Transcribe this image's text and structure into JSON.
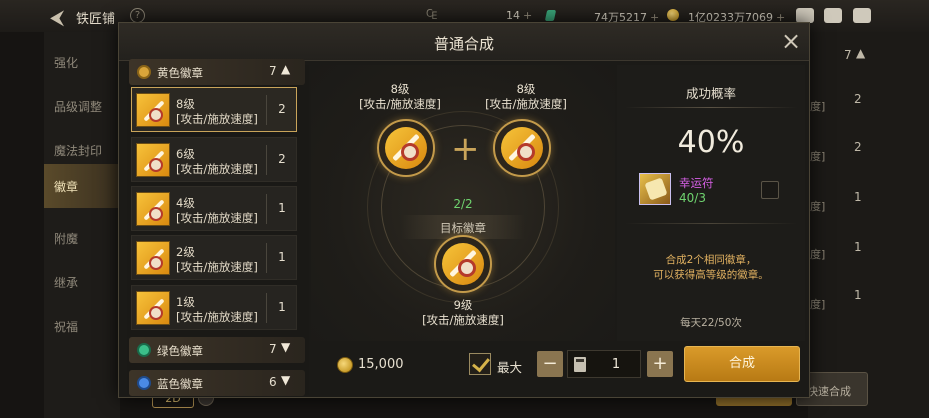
{
  "topbar": {
    "title": "铁匠铺",
    "help": "?",
    "currency_1": "14",
    "currency_2": "74万5217",
    "currency_3": "1亿0233万7069",
    "plus": "+"
  },
  "left_menu": {
    "items": [
      {
        "label": "强化"
      },
      {
        "label": "品级调整"
      },
      {
        "label": "魔法封印"
      },
      {
        "label": "徽章"
      },
      {
        "label": "附魔"
      },
      {
        "label": "继承"
      },
      {
        "label": "祝福"
      }
    ]
  },
  "background_right": {
    "count_top": "7",
    "rows": [
      {
        "text": "度]",
        "count": "2"
      },
      {
        "text": "度]",
        "count": "2"
      },
      {
        "text": "度]",
        "count": "1"
      },
      {
        "text": "度]",
        "count": "1"
      },
      {
        "text": "度]",
        "count": "1"
      }
    ],
    "quick_button": "快速合成",
    "bottom_badge": "2D"
  },
  "dialog": {
    "title": "普通合成",
    "close": "×",
    "categories": {
      "yellow": {
        "name": "黄色徽章",
        "count": "7",
        "chevron": "▲",
        "color": "#d9a53a"
      },
      "green": {
        "name": "绿色徽章",
        "count": "7",
        "chevron": "▼",
        "color": "#3bbf8a"
      },
      "blue": {
        "name": "蓝色徽章",
        "count": "6",
        "chevron": "▼",
        "color": "#4a8ae6"
      }
    },
    "items": [
      {
        "level": "8级",
        "desc": "[攻击/施放速度]",
        "count": "2"
      },
      {
        "level": "6级",
        "desc": "[攻击/施放速度]",
        "count": "2"
      },
      {
        "level": "4级",
        "desc": "[攻击/施放速度]",
        "count": "1"
      },
      {
        "level": "2级",
        "desc": "[攻击/施放速度]",
        "count": "1"
      },
      {
        "level": "1级",
        "desc": "[攻击/施放速度]",
        "count": "1"
      }
    ],
    "synth": {
      "left_level": "8级",
      "left_desc": "[攻击/施放速度]",
      "right_level": "8级",
      "right_desc": "[攻击/施放速度]",
      "plus": "+",
      "progress": "2/2",
      "target_label": "目标徽章",
      "result_level": "9级",
      "result_desc": "[攻击/施放速度]"
    },
    "info": {
      "rate_title": "成功概率",
      "rate_value": "40%",
      "luck_name": "幸运符",
      "luck_count": "40/3",
      "hint_line1": "合成2个相同徽章，",
      "hint_line2": "可以获得高等级的徽章。",
      "daily": "每天22/50次"
    },
    "bottom": {
      "cost": "15,000",
      "max_label": "最大",
      "minus": "−",
      "quantity": "1",
      "plus": "+",
      "synth_button": "合成"
    }
  }
}
